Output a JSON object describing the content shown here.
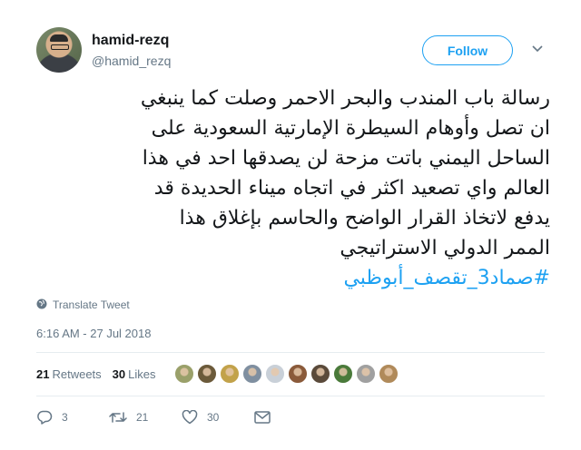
{
  "user": {
    "display_name": "hamid-rezq",
    "screen_name": "@hamid_rezq"
  },
  "follow_button": {
    "label": "Follow",
    "color": "#1da1f2"
  },
  "tweet": {
    "text": "رسالة باب المندب والبحر الاحمر وصلت كما ينبغي\nان تصل وأوهام السيطرة الإمارتية السعودية على\nالساحل اليمني باتت مزحة لن يصدقها احد في هذا\nالعالم واي تصعيد اكثر في اتجاه ميناء الحديدة قد\nيدفع لاتخاذ القرار الواضح والحاسم بإغلاق هذا\nالممر الدولي الاستراتيجي",
    "hashtag": "#صماد3_تقصف_أبوظبي"
  },
  "translate_label": "Translate Tweet",
  "timestamp": "6:16 AM - 27 Jul 2018",
  "stats": {
    "retweets_count": "21",
    "retweets_label": "Retweets",
    "likes_count": "30",
    "likes_label": "Likes"
  },
  "facepile_colors": [
    "#9aa06a",
    "#6b5a3a",
    "#c2a24a",
    "#7f8fa0",
    "#c9d0d8",
    "#8a5a3a",
    "#5a4a3a",
    "#4a7a3a",
    "#a0a0a0",
    "#b08a5a"
  ],
  "actions": {
    "reply_count": "3",
    "retweet_count": "21",
    "like_count": "30"
  }
}
